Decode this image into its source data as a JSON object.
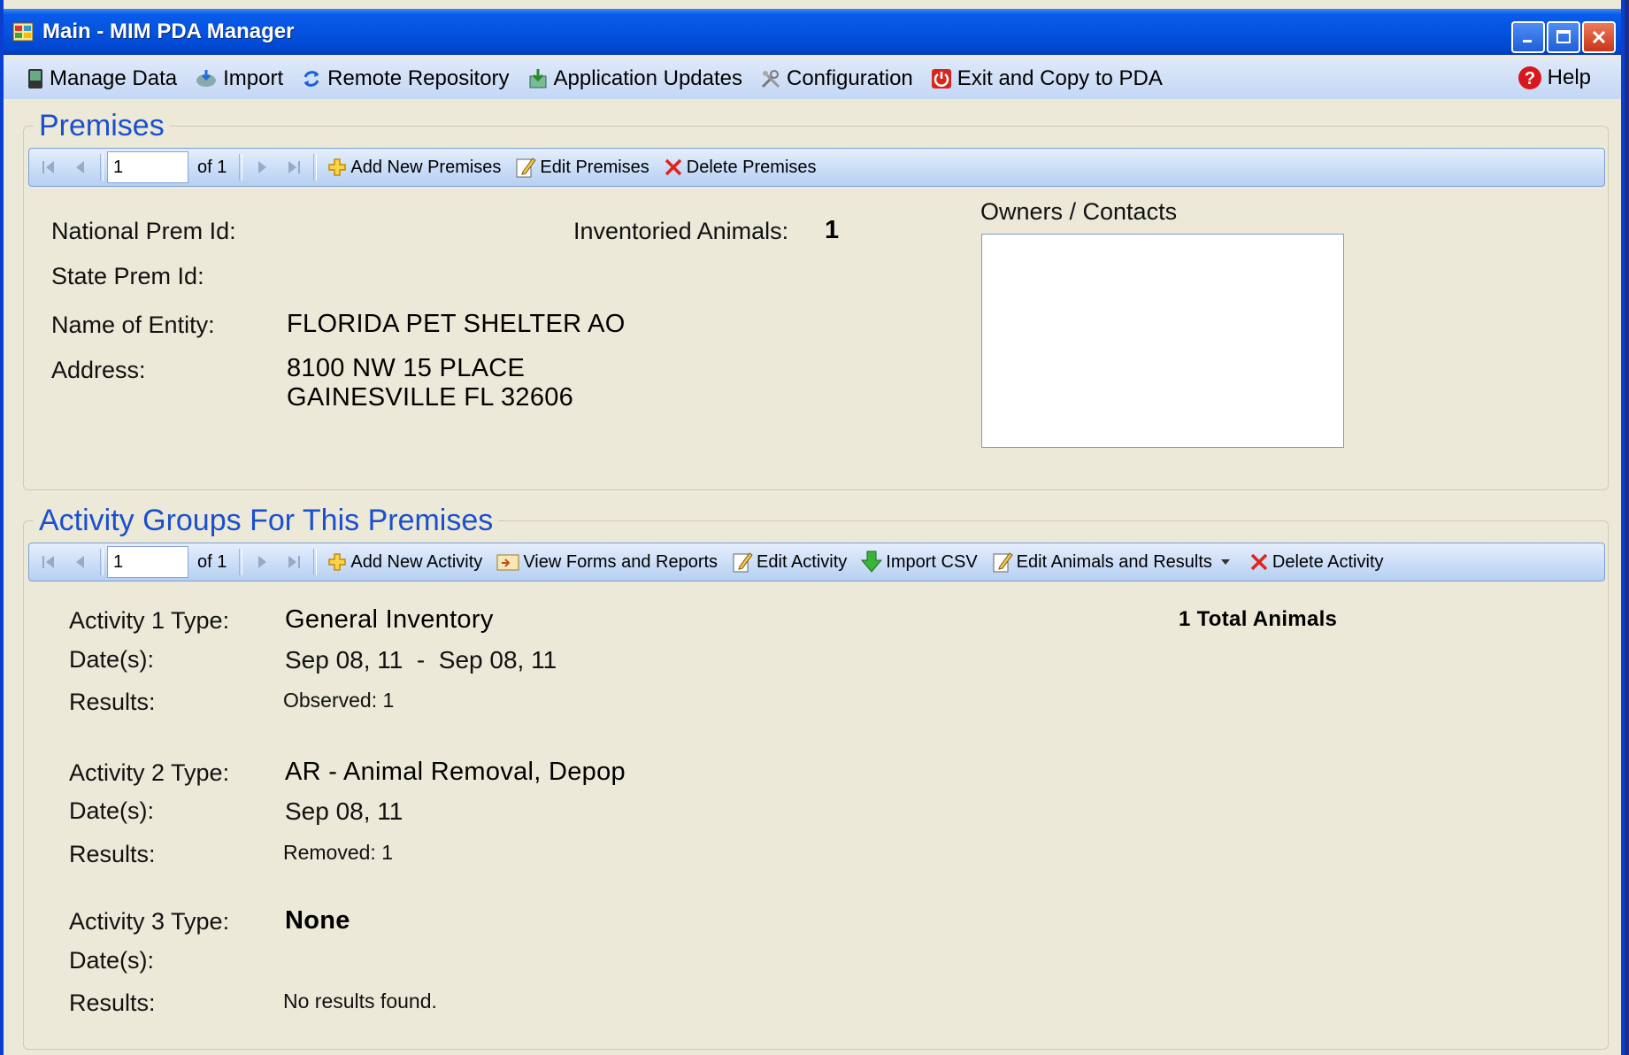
{
  "window": {
    "title": "Main - MIM PDA Manager"
  },
  "menu": {
    "items": [
      {
        "label": "Manage Data",
        "icon": "pda-device-icon"
      },
      {
        "label": "Import",
        "icon": "import-icon"
      },
      {
        "label": "Remote Repository",
        "icon": "sync-arrows-icon"
      },
      {
        "label": "Application Updates",
        "icon": "update-icon"
      },
      {
        "label": "Configuration",
        "icon": "tools-icon"
      },
      {
        "label": "Exit and Copy to PDA",
        "icon": "power-icon"
      }
    ],
    "help": "Help"
  },
  "premises": {
    "title": "Premises",
    "nav": {
      "position": "1",
      "of": "of 1"
    },
    "toolbar": {
      "add": "Add New Premises",
      "edit": "Edit Premises",
      "delete": "Delete Premises"
    },
    "labels": {
      "national_prem_id": "National Prem Id:",
      "state_prem_id": "State Prem Id:",
      "name_of_entity": "Name of Entity:",
      "address": "Address:",
      "inventoried_animals": "Inventoried Animals:"
    },
    "values": {
      "inventoried_animals": "1",
      "name_of_entity": "FLORIDA PET SHELTER AO",
      "address_line1": "8100 NW 15 PLACE",
      "address_line2": "GAINESVILLE FL 32606"
    },
    "owners_label": "Owners / Contacts"
  },
  "activities": {
    "title": "Activity Groups For This Premises",
    "nav": {
      "position": "1",
      "of": "of 1"
    },
    "toolbar": {
      "add": "Add New Activity",
      "view_forms": "View Forms and Reports",
      "edit": "Edit Activity",
      "import_csv": "Import CSV",
      "edit_animals": "Edit Animals and Results",
      "delete": "Delete Activity"
    },
    "total_animals": "1 Total Animals",
    "items": [
      {
        "type_label": "Activity 1 Type:",
        "type": "General Inventory",
        "dates_label": "Date(s):",
        "dates": "Sep 08, 11  -  Sep 08, 11",
        "results_label": "Results:",
        "results": "Observed: 1"
      },
      {
        "type_label": "Activity 2 Type:",
        "type": "AR - Animal Removal, Depop",
        "dates_label": "Date(s):",
        "dates": "Sep 08, 11",
        "results_label": "Results:",
        "results": "Removed: 1"
      },
      {
        "type_label": "Activity 3 Type:",
        "type": "None",
        "dates_label": "Date(s):",
        "dates": "",
        "results_label": "Results:",
        "results": "No results found."
      }
    ]
  }
}
